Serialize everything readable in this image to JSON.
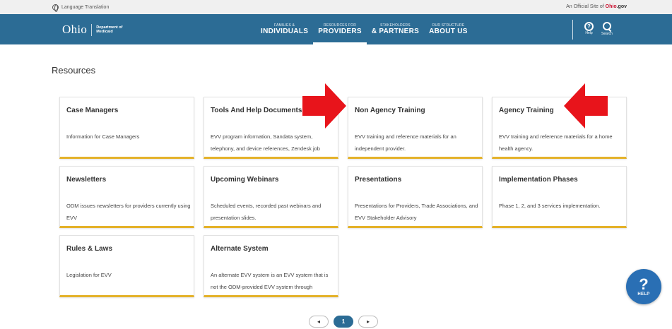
{
  "utility": {
    "language": "Language Translation",
    "official_prefix": "An Official Site of",
    "official_brand": "Ohio",
    "official_suffix": ".gov"
  },
  "header": {
    "logo_ohio": "Ohio",
    "logo_dept_line1": "Department of",
    "logo_dept_line2": "Medicaid",
    "nav": [
      {
        "small": "FAMILIES &",
        "big": "INDIVIDUALS"
      },
      {
        "small": "RESOURCES FOR",
        "big": "PROVIDERS"
      },
      {
        "small": "STAKEHOLDERS",
        "big": "& PARTNERS"
      },
      {
        "small": "OUR STRUCTURE",
        "big": "ABOUT US"
      }
    ],
    "help_label": "Help",
    "search_label": "Search"
  },
  "page": {
    "title": "Resources"
  },
  "cards": [
    {
      "title": "Case Managers",
      "desc": "Information for Case Managers"
    },
    {
      "title": "Tools And Help Documents",
      "desc": "EVV program information, Sandata system, telephony, and device references, Zendesk job"
    },
    {
      "title": "Non Agency Training",
      "desc": "EVV training and reference materials for an independent provider."
    },
    {
      "title": "Agency Training",
      "desc": "EVV training and reference materials for a home health agency."
    },
    {
      "title": "Newsletters",
      "desc": "ODM issues newsletters for providers currently using EVV"
    },
    {
      "title": "Upcoming Webinars",
      "desc": "Scheduled events, recorded past webinars and presentation slides."
    },
    {
      "title": "Presentations",
      "desc": "Presentations for Providers, Trade Associations, and EVV Stakeholder Advisory"
    },
    {
      "title": "Implementation Phases",
      "desc": "Phase 1, 2, and 3 services implementation."
    },
    {
      "title": "Rules & Laws",
      "desc": "Legislation for EVV"
    },
    {
      "title": "Alternate System",
      "desc": "An alternate EVV system is an EVV system that is not the ODM-provided EVV system through"
    }
  ],
  "pager": {
    "prev": "◂",
    "current": "1",
    "next": "▸"
  },
  "help_widget": {
    "symbol": "?",
    "label": "HELP"
  },
  "colors": {
    "header_bg": "#2c6c95",
    "card_accent": "#e4b22a",
    "annotation_arrow": "#e8141b",
    "help_bubble": "#2a6fb4"
  }
}
